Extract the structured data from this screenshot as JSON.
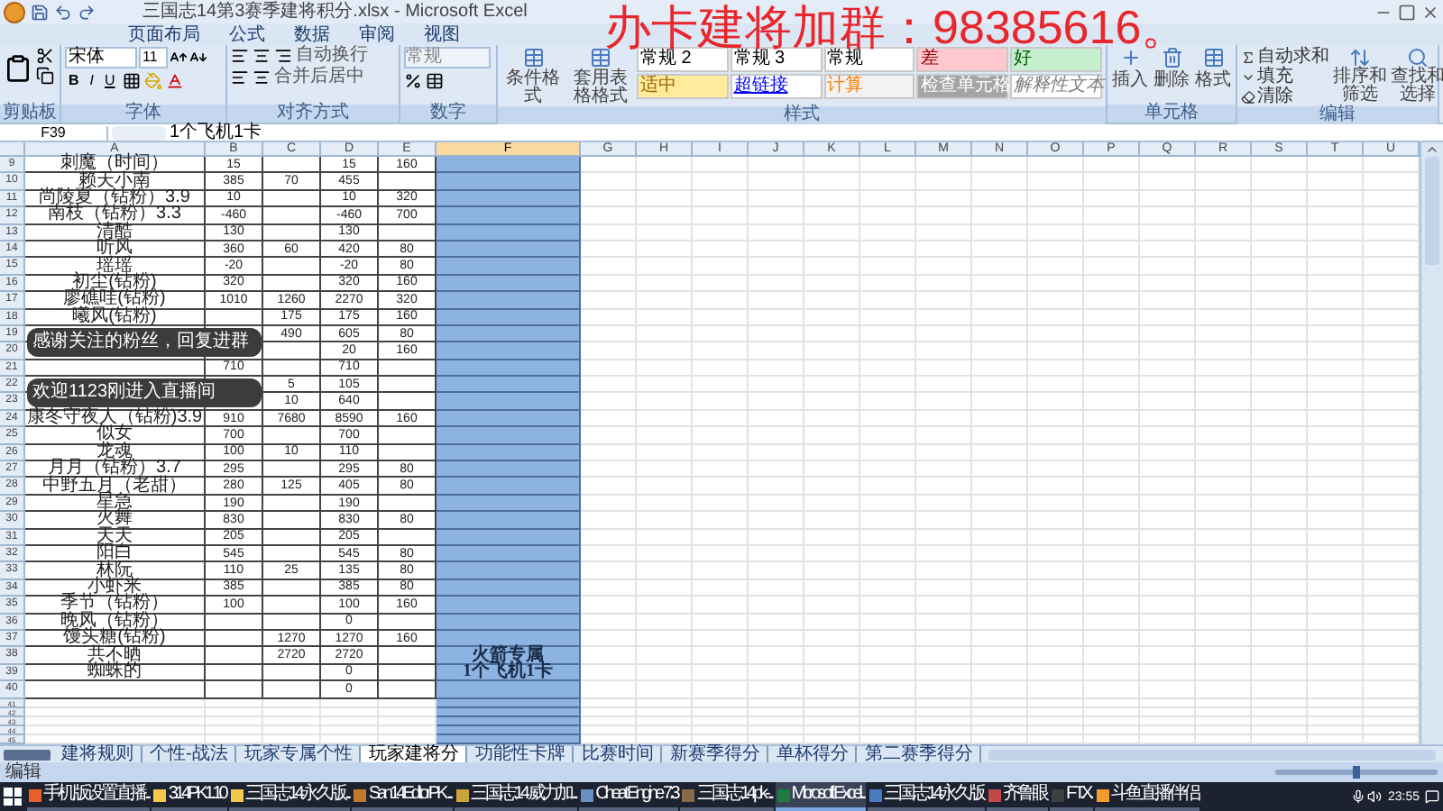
{
  "window": {
    "title": "三国志14第3赛季建将积分.xlsx - Microsoft Excel"
  },
  "menu_tabs": [
    {
      "label": "页面布局",
      "selected": false
    },
    {
      "label": "公式",
      "selected": false
    },
    {
      "label": "数据",
      "selected": false
    },
    {
      "label": "审阅",
      "selected": false
    },
    {
      "label": "视图",
      "selected": false
    }
  ],
  "ribbon": {
    "groups": [
      {
        "kind": "clipboard",
        "label": "剪贴板"
      },
      {
        "kind": "font",
        "label": "字体",
        "font": "宋体",
        "size": "11",
        "bold": "B",
        "italic": "I",
        "underline": "U"
      },
      {
        "kind": "alignment",
        "label": "对齐方式",
        "wrap": "自动换行",
        "merge": "合并后居中"
      },
      {
        "kind": "number",
        "label": "数字",
        "format": "常规"
      },
      {
        "kind": "styles",
        "label": "样式",
        "buttons": [
          "条件格式",
          "套用表格格式"
        ],
        "cell_styles": [
          {
            "label": "常规 2",
            "kind": "normal"
          },
          {
            "label": "常规 3",
            "kind": "normal"
          },
          {
            "label": "常规",
            "kind": "normal"
          },
          {
            "label": "差",
            "kind": "bad"
          },
          {
            "label": "好",
            "kind": "good"
          },
          {
            "label": "适中",
            "kind": "neutral"
          },
          {
            "label": "超链接",
            "kind": "link"
          },
          {
            "label": "计算",
            "kind": "calc"
          },
          {
            "label": "检查单元格",
            "kind": "check"
          },
          {
            "label": "解释性文本",
            "kind": "note"
          }
        ]
      },
      {
        "kind": "cells",
        "label": "单元格",
        "buttons": [
          "插入",
          "删除",
          "格式"
        ]
      },
      {
        "kind": "editing",
        "label": "编辑",
        "small": [
          "自动求和",
          "填充",
          "清除"
        ],
        "buttons": [
          "排序和筛选",
          "查找和选择"
        ]
      }
    ]
  },
  "formula_bar": {
    "name_box": "F39",
    "formula": "1个飞机1卡"
  },
  "columns": [
    {
      "label": "A",
      "selected": false
    },
    {
      "label": "B",
      "selected": false
    },
    {
      "label": "C",
      "selected": false
    },
    {
      "label": "D",
      "selected": false
    },
    {
      "label": "E",
      "selected": false
    },
    {
      "label": "F",
      "selected": true
    },
    {
      "label": "G",
      "selected": false
    },
    {
      "label": "H",
      "selected": false
    },
    {
      "label": "I",
      "selected": false
    },
    {
      "label": "J",
      "selected": false
    },
    {
      "label": "K",
      "selected": false
    },
    {
      "label": "L",
      "selected": false
    },
    {
      "label": "M",
      "selected": false
    },
    {
      "label": "N",
      "selected": false
    },
    {
      "label": "O",
      "selected": false
    },
    {
      "label": "P",
      "selected": false
    },
    {
      "label": "Q",
      "selected": false
    },
    {
      "label": "R",
      "selected": false
    },
    {
      "label": "S",
      "selected": false
    },
    {
      "label": "T",
      "selected": false
    },
    {
      "label": "U",
      "selected": false
    }
  ],
  "rows": [
    {
      "number": "9",
      "cells": [
        "刺魔（时间）",
        "15",
        null,
        "15",
        "160",
        null
      ]
    },
    {
      "number": "10",
      "cells": [
        "赖天小南",
        "385",
        "70",
        "455",
        null,
        null
      ]
    },
    {
      "number": "11",
      "cells": [
        "尚陵夏（钻粉）3.9",
        "10",
        null,
        "10",
        "320",
        null
      ]
    },
    {
      "number": "12",
      "cells": [
        "南枝（钻粉）3.3",
        "-460",
        null,
        "-460",
        "700",
        null
      ]
    },
    {
      "number": "13",
      "cells": [
        "清酷",
        "130",
        null,
        "130",
        null,
        null
      ]
    },
    {
      "number": "14",
      "cells": [
        "听风",
        "360",
        "60",
        "420",
        "80",
        null
      ]
    },
    {
      "number": "15",
      "cells": [
        "瑶瑶",
        "-20",
        null,
        "-20",
        "80",
        null
      ]
    },
    {
      "number": "16",
      "cells": [
        "初尘(钻粉)",
        "320",
        null,
        "320",
        "160",
        null
      ]
    },
    {
      "number": "17",
      "cells": [
        "廖礁哇(钻粉)",
        "1010",
        "1260",
        "2270",
        "320",
        null
      ]
    },
    {
      "number": "18",
      "cells": [
        "曦风(钻粉)",
        null,
        "175",
        "175",
        "160",
        null
      ]
    },
    {
      "number": "19",
      "cells": [
        null,
        null,
        "490",
        "605",
        "80",
        null
      ]
    },
    {
      "number": "20",
      "cells": [
        null,
        null,
        null,
        "20",
        "160",
        null
      ]
    },
    {
      "number": "21",
      "cells": [
        null,
        "710",
        null,
        "710",
        null,
        null
      ]
    },
    {
      "number": "22",
      "cells": [
        null,
        null,
        "5",
        "105",
        null,
        null
      ]
    },
    {
      "number": "23",
      "cells": [
        null,
        null,
        "10",
        "640",
        null,
        null
      ]
    },
    {
      "number": "24",
      "cells": [
        "康冬守夜人（钻粉)3.9",
        "910",
        "7680",
        "8590",
        "160",
        null
      ]
    },
    {
      "number": "25",
      "cells": [
        "似女",
        "700",
        null,
        "700",
        null,
        null
      ]
    },
    {
      "number": "26",
      "cells": [
        "龙魂",
        "100",
        "10",
        "110",
        null,
        null
      ]
    },
    {
      "number": "27",
      "cells": [
        "月月（钻粉）3.7",
        "295",
        null,
        "295",
        "80",
        null
      ]
    },
    {
      "number": "28",
      "cells": [
        "中野五月（老甜）",
        "280",
        "125",
        "405",
        "80",
        null
      ]
    },
    {
      "number": "29",
      "cells": [
        "星急",
        "190",
        null,
        "190",
        null,
        null
      ]
    },
    {
      "number": "30",
      "cells": [
        "火舞",
        "830",
        null,
        "830",
        "80",
        null
      ]
    },
    {
      "number": "31",
      "cells": [
        "天天",
        "205",
        null,
        "205",
        null,
        null
      ]
    },
    {
      "number": "32",
      "cells": [
        "阳白",
        "545",
        null,
        "545",
        "80",
        null
      ]
    },
    {
      "number": "33",
      "cells": [
        "林阮",
        "110",
        "25",
        "135",
        "80",
        null
      ]
    },
    {
      "number": "34",
      "cells": [
        "小虾米",
        "385",
        null,
        "385",
        "80",
        null
      ]
    },
    {
      "number": "35",
      "cells": [
        "季节（钻粉）",
        "100",
        null,
        "100",
        "160",
        null
      ]
    },
    {
      "number": "36",
      "cells": [
        "晚风（钻粉）",
        null,
        null,
        "0",
        null,
        null
      ]
    },
    {
      "number": "37",
      "cells": [
        "馒头糖(钻粉)",
        null,
        "1270",
        "1270",
        "160",
        null
      ]
    },
    {
      "number": "38",
      "cells": [
        "共不晒",
        null,
        "2720",
        "2720",
        null,
        "火箭专属"
      ]
    },
    {
      "number": "39",
      "cells": [
        "蜘蛛的",
        null,
        null,
        "0",
        null,
        "1个飞机1卡"
      ]
    },
    {
      "number": "40",
      "cells": [
        null,
        null,
        null,
        "0",
        null,
        null
      ]
    },
    {
      "number": "41"
    },
    {
      "number": "42"
    },
    {
      "number": "43"
    },
    {
      "number": "44"
    },
    {
      "number": "45"
    }
  ],
  "overlay": {
    "banner": "办卡建将加群：98385616。",
    "notifications": [
      "感谢关注的粉丝，回复进群",
      "欢迎1123刚进入直播间"
    ]
  },
  "sheet_tabs": [
    {
      "label": "建将规则",
      "selected": false
    },
    {
      "label": "个性-战法",
      "selected": false
    },
    {
      "label": "玩家专属个性",
      "selected": false
    },
    {
      "label": "玩家建将分",
      "selected": true
    },
    {
      "label": "功能性卡牌",
      "selected": false
    },
    {
      "label": "比赛时间",
      "selected": false
    },
    {
      "label": "新赛季得分",
      "selected": false
    },
    {
      "label": "单杯得分",
      "selected": false
    },
    {
      "label": "第二赛季得分",
      "selected": false
    }
  ],
  "status_bar": {
    "mode": "编辑",
    "zoom": {
      "level": 0.5
    }
  },
  "taskbar": {
    "items": [
      {
        "label": "手机版设置直播...",
        "selected": false,
        "color": "#e8602c"
      },
      {
        "label": "314PK1.10",
        "selected": false,
        "color": "#f2c94c"
      },
      {
        "label": "三国志14永久版...",
        "selected": false,
        "color": "#f2c94c"
      },
      {
        "label": "San14EditorPK ...",
        "selected": false,
        "color": "#c07a2c"
      },
      {
        "label": "三国志14 威力加...",
        "selected": false,
        "color": "#c9a53a"
      },
      {
        "label": "Cheat Engine 7.3",
        "selected": false,
        "color": "#6a8fc0"
      },
      {
        "label": "三国志14pk-...",
        "selected": false,
        "color": "#8a6a4a"
      },
      {
        "label": "Microsoft Excel...",
        "selected": true,
        "color": "#1f7a3f"
      },
      {
        "label": "三国志14永久版",
        "selected": false,
        "color": "#4a7ac0"
      },
      {
        "label": "齐鲁眼",
        "selected": false,
        "color": "#c04a4a"
      },
      {
        "label": "F T.X.",
        "selected": false,
        "color": "#404040"
      },
      {
        "label": "斗鱼直播伴侣",
        "selected": false,
        "color": "#f29c2c"
      }
    ],
    "clock": "23:55"
  }
}
